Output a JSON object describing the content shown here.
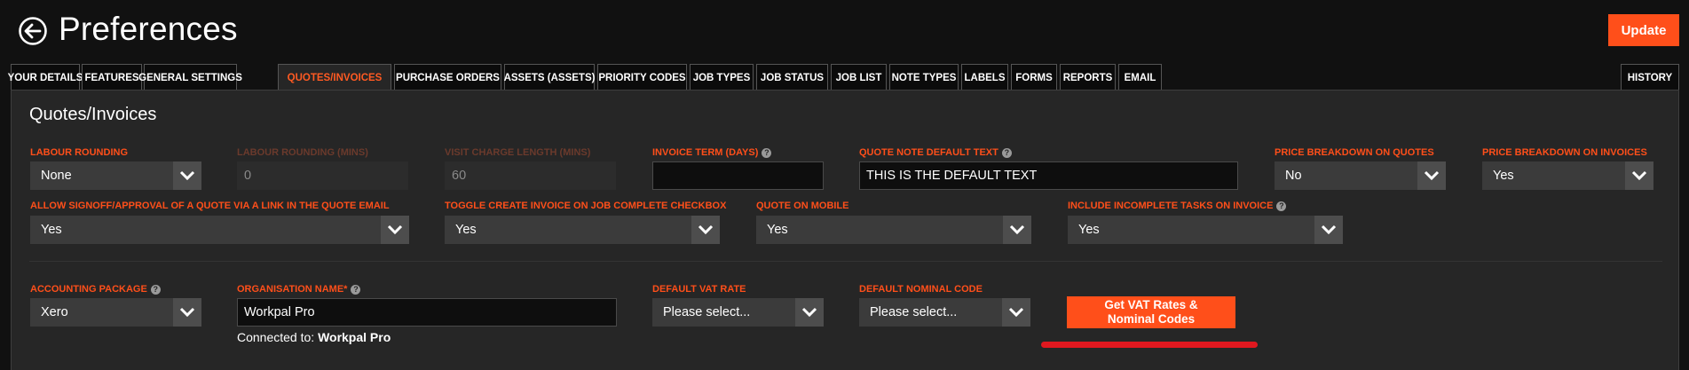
{
  "header": {
    "title": "Preferences",
    "update_label": "Update"
  },
  "tabs": [
    {
      "label": "YOUR DETAILS",
      "active": false
    },
    {
      "label": "FEATURES",
      "active": false
    },
    {
      "label": "GENERAL SETTINGS",
      "active": false
    },
    {
      "label": "QUOTES/INVOICES",
      "active": true
    },
    {
      "label": "PURCHASE ORDERS",
      "active": false
    },
    {
      "label": "ASSETS (ASSETS)",
      "active": false
    },
    {
      "label": "PRIORITY CODES",
      "active": false
    },
    {
      "label": "JOB TYPES",
      "active": false
    },
    {
      "label": "JOB STATUS",
      "active": false
    },
    {
      "label": "JOB LIST",
      "active": false
    },
    {
      "label": "NOTE TYPES",
      "active": false
    },
    {
      "label": "LABELS",
      "active": false
    },
    {
      "label": "FORMS",
      "active": false
    },
    {
      "label": "REPORTS",
      "active": false
    },
    {
      "label": "EMAIL",
      "active": false
    },
    {
      "label": "HISTORY",
      "active": false
    }
  ],
  "section": {
    "title": "Quotes/Invoices"
  },
  "fields": {
    "labour_rounding": {
      "label": "LABOUR ROUNDING",
      "value": "None"
    },
    "labour_rounding_mins": {
      "label": "LABOUR ROUNDING (MINS)",
      "value": "0"
    },
    "visit_charge_length": {
      "label": "VISIT CHARGE LENGTH (MINS)",
      "value": "60"
    },
    "invoice_term": {
      "label": "INVOICE TERM (DAYS)",
      "value": ""
    },
    "quote_note_default": {
      "label": "QUOTE NOTE DEFAULT TEXT",
      "value": "THIS IS THE DEFAULT TEXT"
    },
    "price_breakdown_quotes": {
      "label": "PRICE BREAKDOWN ON QUOTES",
      "value": "No"
    },
    "price_breakdown_invoices": {
      "label": "PRICE BREAKDOWN ON INVOICES",
      "value": "Yes"
    },
    "allow_signoff": {
      "label": "ALLOW SIGNOFF/APPROVAL OF A QUOTE VIA A LINK IN THE QUOTE EMAIL",
      "value": "Yes"
    },
    "toggle_create_invoice": {
      "label": "TOGGLE CREATE INVOICE ON JOB COMPLETE CHECKBOX",
      "value": "Yes"
    },
    "quote_on_mobile": {
      "label": "QUOTE ON MOBILE",
      "value": "Yes"
    },
    "include_incomplete": {
      "label": "INCLUDE INCOMPLETE TASKS ON INVOICE",
      "value": "Yes"
    },
    "accounting_package": {
      "label": "ACCOUNTING PACKAGE",
      "value": "Xero"
    },
    "organisation_name": {
      "label": "ORGANISATION NAME*",
      "value": "Workpal Pro"
    },
    "default_vat_rate": {
      "label": "DEFAULT VAT RATE",
      "value": "Please select..."
    },
    "default_nominal_code": {
      "label": "DEFAULT NOMINAL CODE",
      "value": "Please select..."
    }
  },
  "connected": {
    "prefix": "Connected to:",
    "name": "Workpal Pro"
  },
  "vat_button": {
    "line1": "Get VAT Rates &",
    "line2": "Nominal Codes"
  },
  "help_glyph": "?",
  "colors": {
    "accent": "#ff4f1a",
    "annotation": "#e0181f",
    "background": "#111111",
    "panel": "#262626"
  }
}
